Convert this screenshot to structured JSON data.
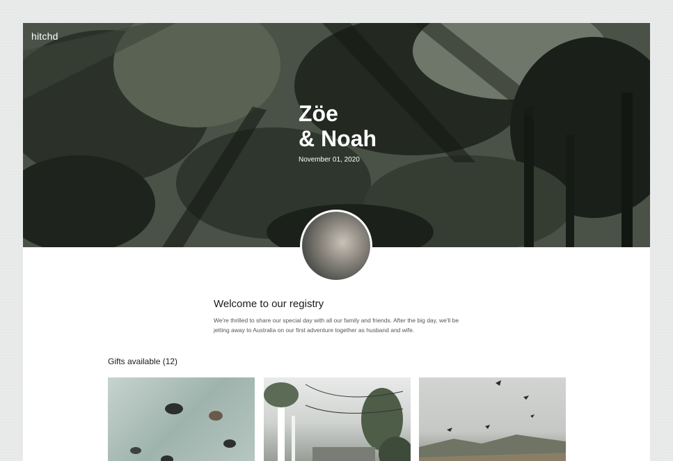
{
  "brand": {
    "logo": "hitchd"
  },
  "hero": {
    "name_line1": "Zöe",
    "name_line2": "& Noah",
    "date": "November 01, 2020"
  },
  "welcome": {
    "title": "Welcome to our registry",
    "text": "We're thrilled to share our special day with all our family and friends. After the big day, we'll be jetting away to Australia on our first adventure together as husband and wife."
  },
  "gifts": {
    "title": "Gifts available (12)",
    "items": [
      {
        "image": "stingrays-ocean-photo"
      },
      {
        "image": "patio-garden-photo"
      },
      {
        "image": "kites-mountains-photo"
      }
    ]
  }
}
